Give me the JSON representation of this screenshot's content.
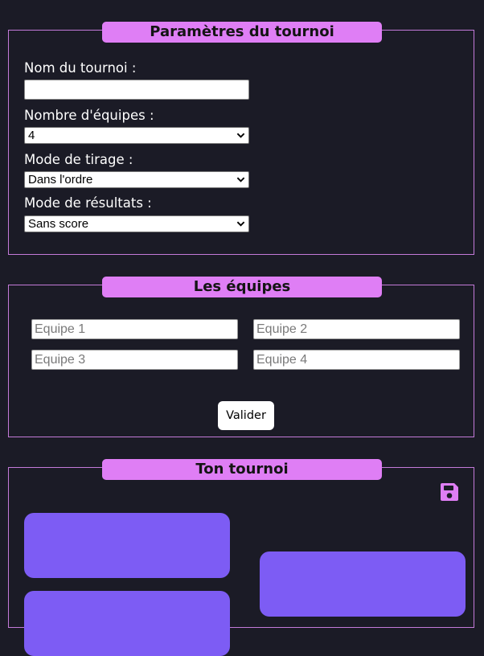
{
  "settings": {
    "legend": "Paramètres du tournoi",
    "name_label": "Nom du tournoi :",
    "name_value": "",
    "teams_label": "Nombre d'équipes :",
    "teams_value": "4",
    "draw_label": "Mode de tirage :",
    "draw_value": "Dans l'ordre",
    "results_label": "Mode de résultats :",
    "results_value": "Sans score"
  },
  "teams": {
    "legend": "Les équipes",
    "placeholders": [
      "Equipe 1",
      "Equipe 2",
      "Equipe 3",
      "Equipe 4"
    ],
    "validate_label": "Valider"
  },
  "tournament": {
    "legend": "Ton tournoi",
    "save_icon": "floppy-disk-icon",
    "match_color": "#7d5cf4"
  },
  "colors": {
    "background": "#1b1b26",
    "accent": "#df7ef5",
    "border": "#c47ad9"
  }
}
